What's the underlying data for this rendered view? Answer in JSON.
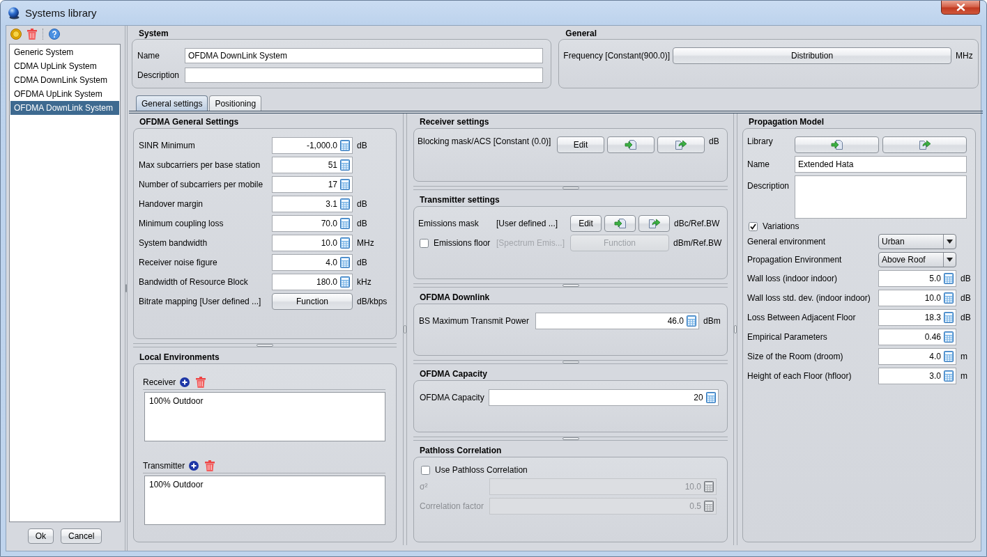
{
  "window": {
    "title": "Systems library"
  },
  "systems": [
    {
      "label": "Generic System",
      "selected": false
    },
    {
      "label": "CDMA UpLink System",
      "selected": false
    },
    {
      "label": "CDMA DownLink System",
      "selected": false
    },
    {
      "label": "OFDMA UpLink System",
      "selected": false
    },
    {
      "label": "OFDMA DownLink System",
      "selected": true
    }
  ],
  "dialog_buttons": [
    "Ok",
    "Cancel"
  ],
  "system_group": {
    "title": "System",
    "fields": [
      {
        "label": "Name",
        "value": "OFDMA DownLink System"
      },
      {
        "label": "Description"
      }
    ]
  },
  "general_group": {
    "title": "General",
    "label": "Frequency [Constant(900.0)]",
    "button": "Distribution",
    "unit": "MHz"
  },
  "tabs": [
    {
      "label": "General settings",
      "selected": true
    },
    {
      "label": "Positioning",
      "selected": false
    }
  ],
  "columns": [
    {
      "sections": [
        {
          "title": "OFDMA General Settings",
          "rows": [
            {
              "kind": "number",
              "label": "SINR Minimum",
              "value": "-1,000.0",
              "unit": "dB"
            },
            {
              "kind": "number",
              "label": "Max subcarriers per base station",
              "value": "51"
            },
            {
              "kind": "number",
              "label": "Number of subcarriers per mobile",
              "value": "17"
            },
            {
              "kind": "number",
              "label": "Handover margin",
              "value": "3.1",
              "unit": "dB"
            },
            {
              "kind": "number",
              "label": "Minimum coupling loss",
              "value": "70.0",
              "unit": "dB"
            },
            {
              "kind": "number",
              "label": "System bandwidth",
              "value": "10.0",
              "unit": "MHz"
            },
            {
              "kind": "number",
              "label": "Receiver noise figure",
              "value": "4.0",
              "unit": "dB"
            },
            {
              "kind": "number",
              "label": "Bandwidth of Resource Block",
              "value": "180.0",
              "unit": "kHz"
            },
            {
              "kind": "function",
              "label": "Bitrate mapping [User defined ...]",
              "button": "Function",
              "unit": "dB/kbps"
            }
          ]
        },
        {
          "title": "Local Environments",
          "rows": [
            {
              "kind": "list",
              "label": "Receiver",
              "items": [
                "100% Outdoor"
              ]
            },
            {
              "kind": "list",
              "label": "Transmitter",
              "items": [
                "100% Outdoor"
              ]
            }
          ]
        }
      ]
    },
    {
      "sections": [
        {
          "title": "Receiver settings",
          "rows": [
            {
              "kind": "mask",
              "label": "Blocking mask/ACS [Constant (0.0)]",
              "button": "Edit",
              "unit": "dB"
            }
          ]
        },
        {
          "title": "Transmitter settings",
          "rows": [
            {
              "kind": "mask",
              "label": "Emissions mask",
              "note": "[User defined ...]",
              "button": "Edit",
              "unit": "dBc/Ref.BW"
            },
            {
              "kind": "check_function",
              "checked": false,
              "label": "Emissions floor",
              "note": "[Spectrum Emis...]",
              "button": "Function",
              "unit": "dBm/Ref.BW"
            }
          ]
        },
        {
          "title": "OFDMA Downlink",
          "rows": [
            {
              "kind": "number",
              "label": "BS Maximum Transmit Power",
              "value": "46.0",
              "unit": "dBm"
            }
          ]
        },
        {
          "title": "OFDMA Capacity",
          "rows": [
            {
              "kind": "number",
              "label": "OFDMA Capacity",
              "value": "20"
            }
          ]
        },
        {
          "title": "Pathloss Correlation",
          "rows": [
            {
              "kind": "check",
              "checked": false,
              "label": "Use Pathloss Correlation",
              "disabled": false
            },
            {
              "kind": "number",
              "label": "σ²",
              "value": "10.0",
              "disabled": true
            },
            {
              "kind": "number",
              "label": "Correlation factor",
              "value": "0.5",
              "disabled": true
            }
          ]
        }
      ]
    },
    {
      "sections": [
        {
          "title": "Propagation Model",
          "rows": [
            {
              "kind": "library",
              "label": "Library"
            },
            {
              "kind": "text",
              "label": "Name",
              "value": "Extended Hata"
            },
            {
              "kind": "textarea",
              "label": "Description"
            },
            {
              "kind": "check",
              "checked": true,
              "label": "Variations"
            },
            {
              "kind": "select",
              "label": "General environment",
              "value": "Urban"
            },
            {
              "kind": "select",
              "label": "Propagation Environment",
              "value": "Above Roof"
            },
            {
              "kind": "number",
              "label": "Wall loss (indoor indoor)",
              "value": "5.0",
              "unit": "dB"
            },
            {
              "kind": "number",
              "label": "Wall loss std. dev. (indoor indoor)",
              "value": "10.0",
              "unit": "dB"
            },
            {
              "kind": "number",
              "label": "Loss Between Adjacent Floor",
              "value": "18.3",
              "unit": "dB"
            },
            {
              "kind": "number",
              "label": "Empirical Parameters",
              "value": "0.46"
            },
            {
              "kind": "number",
              "label": "Size of the Room (droom)",
              "value": "4.0",
              "unit": "m"
            },
            {
              "kind": "number",
              "label": "Height of each Floor (hfloor)",
              "value": "3.0",
              "unit": "m"
            }
          ]
        }
      ]
    }
  ]
}
